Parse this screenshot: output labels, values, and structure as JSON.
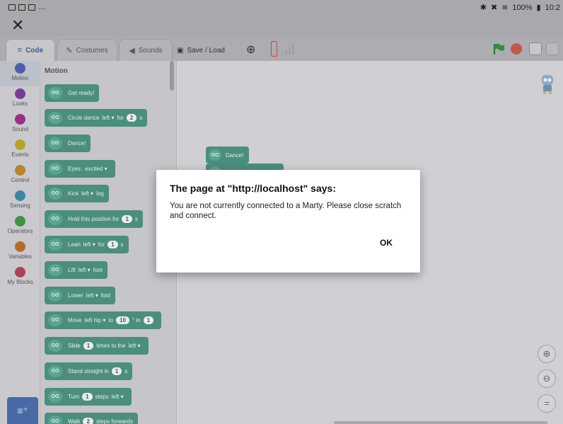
{
  "status_bar": {
    "battery": "100%",
    "time": "10:2"
  },
  "tabs": [
    {
      "label": "Code",
      "icon": "code-icon"
    },
    {
      "label": "Costumes",
      "icon": "brush-icon"
    },
    {
      "label": "Sounds",
      "icon": "speaker-icon"
    }
  ],
  "menu": {
    "save_load": "Save / Load"
  },
  "categories": [
    {
      "label": "Motion",
      "color": "#4c5fa8"
    },
    {
      "label": "Looks",
      "color": "#7a3c9a"
    },
    {
      "label": "Sound",
      "color": "#9a2f85"
    },
    {
      "label": "Events",
      "color": "#b9a326"
    },
    {
      "label": "Control",
      "color": "#b7852a"
    },
    {
      "label": "Sensing",
      "color": "#3e86a3"
    },
    {
      "label": "Operators",
      "color": "#3f9347"
    },
    {
      "label": "Variables",
      "color": "#b76a27"
    },
    {
      "label": "My Blocks",
      "color": "#b0405a"
    }
  ],
  "palette": {
    "title": "Motion",
    "blocks": {
      "get_ready": "Get ready!",
      "circle_dance": {
        "text": "Circle dance",
        "dir": "left ▾",
        "for": "for",
        "num": "2",
        "unit": "s"
      },
      "dance": "Dance!",
      "eyes": {
        "text": "Eyes:",
        "value": "excited ▾"
      },
      "kick": {
        "text": "Kick",
        "dir": "left ▾",
        "unit": "leg"
      },
      "hold": {
        "text": "Hold this position for",
        "num": "1",
        "unit": "s"
      },
      "lean": {
        "text": "Lean",
        "dir": "left ▾",
        "for": "for",
        "num": "1",
        "unit": "s"
      },
      "lift": {
        "text": "Lift",
        "dir": "left ▾",
        "unit": "foot"
      },
      "lower": {
        "text": "Lower",
        "dir": "left ▾",
        "unit": "foot"
      },
      "move": {
        "text": "Move",
        "joint": "left hip ▾",
        "to": "to",
        "num": "10",
        "in": "° in",
        "num2": "1"
      },
      "slide": {
        "text": "Slide",
        "num": "1",
        "times": "times to the",
        "dir": "left ▾"
      },
      "stand": {
        "text": "Stand straight in",
        "num": "1",
        "unit": "s"
      },
      "turn": {
        "text": "Turn",
        "num": "1",
        "steps": "steps",
        "dir": "left ▾"
      },
      "walk": {
        "text": "Walk",
        "num": "2",
        "steps": "steps forwards"
      }
    }
  },
  "workspace": {
    "block_dance": "Dance!"
  },
  "face_glyph": "OO",
  "dialog": {
    "title": "The page at \"http://localhost\" says:",
    "message": "You are not currently connected to a Marty. Please close scratch and connect.",
    "ok": "OK"
  }
}
